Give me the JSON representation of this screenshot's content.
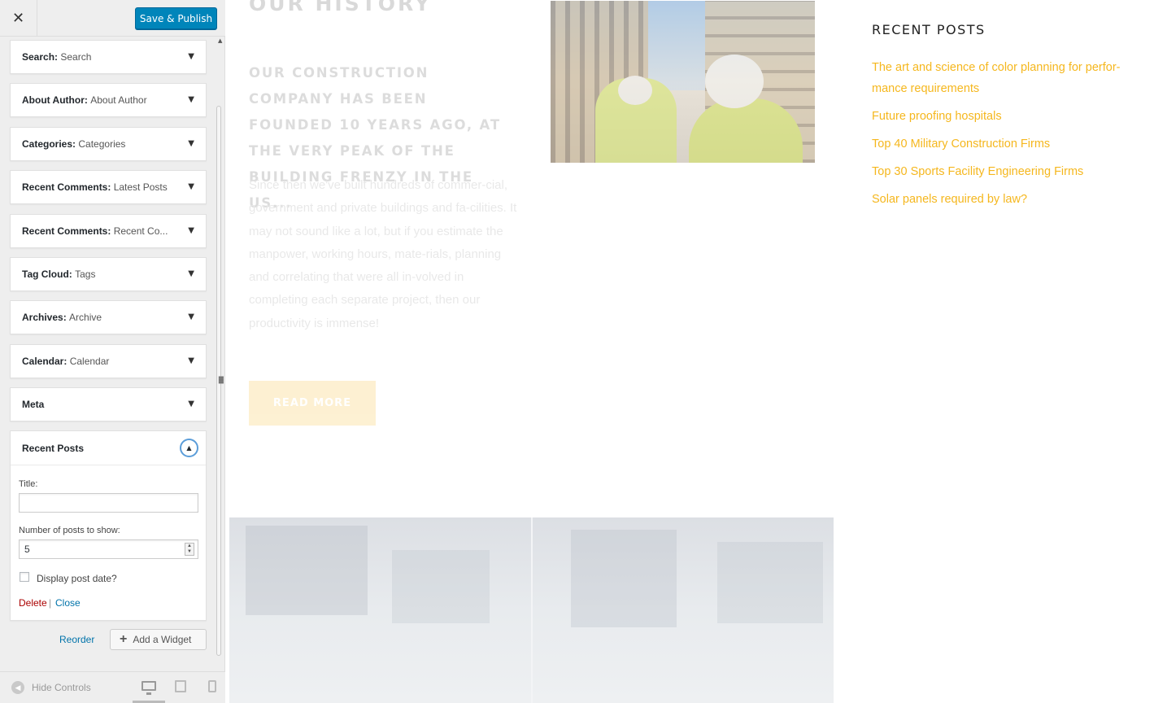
{
  "header": {
    "close_glyph": "✕",
    "publish_label": "Save & Publish"
  },
  "widgets": [
    {
      "name": "Search",
      "sub": "Search"
    },
    {
      "name": "About Author",
      "sub": "About Author"
    },
    {
      "name": "Categories",
      "sub": "Categories"
    },
    {
      "name": "Recent Comments",
      "sub": "Latest Posts"
    },
    {
      "name": "Recent Comments",
      "sub": "Recent Co..."
    },
    {
      "name": "Tag Cloud",
      "sub": "Tags"
    },
    {
      "name": "Archives",
      "sub": "Archive"
    },
    {
      "name": "Calendar",
      "sub": "Calendar"
    },
    {
      "name": "Meta",
      "sub": ""
    }
  ],
  "open_widget": {
    "title": "Recent Posts",
    "title_field_label": "Title:",
    "title_value": "",
    "count_label": "Number of posts to show:",
    "count_value": "5",
    "display_date_label": "Display post date?",
    "display_date_checked": false,
    "delete_label": "Delete",
    "separator": "|",
    "close_label": "Close"
  },
  "actions": {
    "reorder_label": "Reorder",
    "add_widget_label": "Add a Widget"
  },
  "footer": {
    "hide_controls_label": "Hide Controls",
    "active_device": "desktop"
  },
  "icons": {
    "expand": "chevron-down-icon",
    "collapse": "chevron-up-icon",
    "add": "plus-icon",
    "devices": [
      "desktop-icon",
      "tablet-icon",
      "mobile-icon"
    ]
  },
  "preview": {
    "history_title": "OUR HISTORY",
    "history_lead": "OUR CONSTRUCTION COMPANY HAS BEEN FOUNDED 10 YEARS AGO, AT THE VERY PEAK OF THE BUILDING FRENZY IN THE US...",
    "history_body": "Since then we've built hundreds of commer-cial, government and private buildings and fa-cilities. It may not sound like a lot, but if you estimate the manpower, working hours, mate-rials, planning and correlating that were all in-volved in completing each separate project, then our productivity is immense!",
    "read_more_label": "READ MORE",
    "recent_posts_heading": "RECENT POSTS",
    "recent_posts": [
      "The art and science of color planning for perfor-mance requirements",
      "Future proofing hospitals",
      "Top 40 Military Construction Firms",
      "Top 30 Sports Facility Engineering Firms",
      "Solar panels required by law?"
    ]
  },
  "colors": {
    "publish_button": "#0085ba",
    "link": "#0073aa",
    "delete": "#aa0000",
    "accent_yellow": "#f5b71e",
    "sidebar_bg": "#eeeeee"
  }
}
